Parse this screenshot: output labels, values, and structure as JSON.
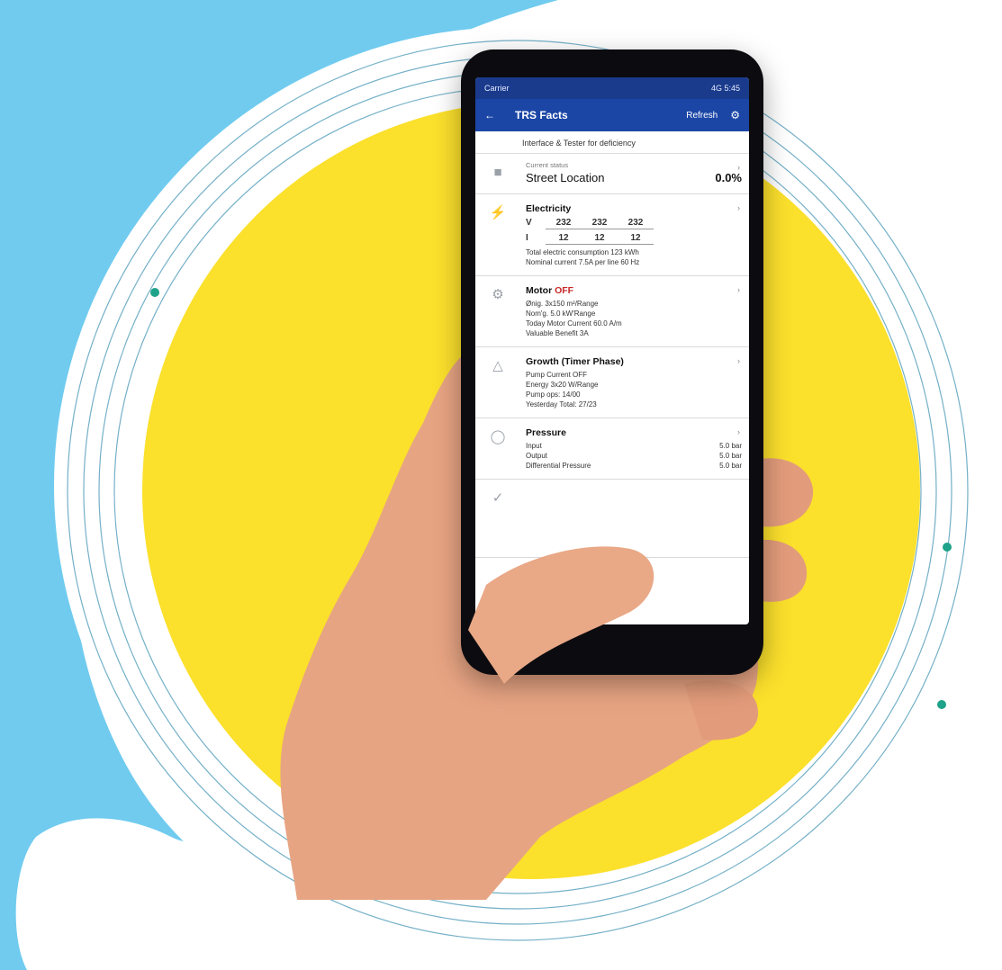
{
  "phone": {
    "status": {
      "carrier": "Carrier",
      "right": "4G 5:45"
    },
    "appbar": {
      "title": "TRS Facts",
      "action": "Refresh"
    },
    "subhead": "Interface & Tester for deficiency",
    "location": {
      "label": "Current status",
      "value": "Street Location",
      "reading": "0.0%"
    },
    "electricity": {
      "title": "Electricity",
      "v_label": "V",
      "i_label": "I",
      "v": [
        "232",
        "232",
        "232"
      ],
      "i": [
        "12",
        "12",
        "12"
      ],
      "line1": "Total electric consumption 123 kWh",
      "line2": "Nominal current 7.5A per line 60 Hz"
    },
    "motor": {
      "title": "Motor",
      "status": "OFF",
      "lines": [
        "Ønig. 3x150 m²/Range",
        "Nom'g. 5.0 kW'Range",
        "Today Motor Current 60.0 A/m",
        "Valuable Benefit 3A"
      ]
    },
    "growth": {
      "title": "Growth (Timer Phase)",
      "lines": [
        "Pump Current OFF",
        "Energy 3x20 W/Range",
        "Pump ops: 14/00",
        "Yesterday Total: 27/23"
      ]
    },
    "pressure": {
      "title": "Pressure",
      "rows": [
        {
          "k": "Input",
          "v": "5.0 bar"
        },
        {
          "k": "Output",
          "v": "5.0 bar"
        },
        {
          "k": "Differential Pressure",
          "v": "5.0 bar"
        }
      ]
    }
  },
  "colors": {
    "sky": "#70cbef",
    "yellow": "#fbe02c",
    "appbar": "#1b46a6",
    "statusbar": "#1a3a8c",
    "ring": "#3a8fb0",
    "dot": "#1fa28a"
  }
}
